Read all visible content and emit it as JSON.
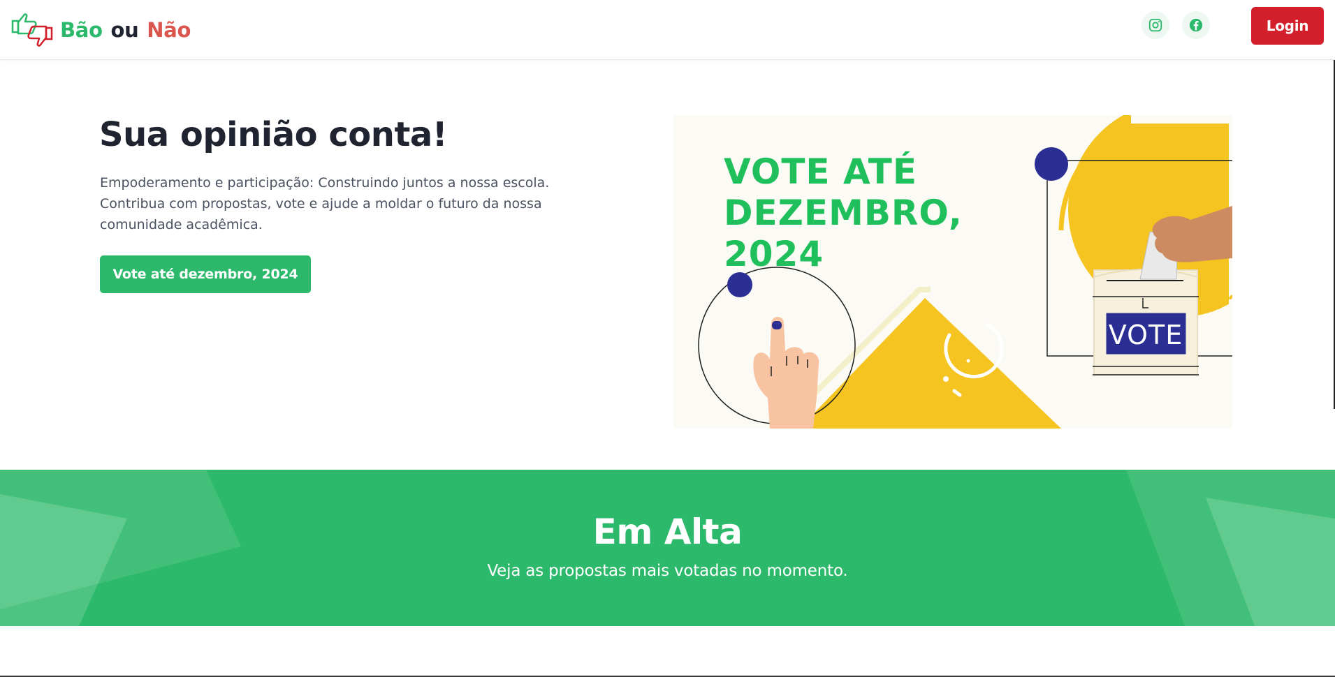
{
  "header": {
    "brand": {
      "part1": "Bão",
      "part2": "ou",
      "part3": "Não"
    },
    "social": [
      {
        "icon": "instagram-icon"
      },
      {
        "icon": "facebook-icon"
      }
    ],
    "login_label": "Login"
  },
  "hero": {
    "title": "Sua opinião conta!",
    "description": "Empoderamento e participação: Construindo juntos a nossa escola. Contribua com propostas, vote e ajude a moldar o futuro da nossa comunidade acadêmica.",
    "cta_label": "Vote até dezembro, 2024",
    "illustration": {
      "headline_lines": [
        "VOTE ATÉ",
        "DEZEMBRO,",
        "2024"
      ],
      "ballot_label": "VOTE"
    }
  },
  "trending": {
    "title": "Em Alta",
    "subtitle": "Veja as propostas mais votadas no momento."
  },
  "colors": {
    "brand_green": "#2db96b",
    "brand_red": "#d9554d",
    "login_red": "#d21f2b",
    "text_dark": "#1f2430",
    "illustration_green": "#1fbf5c",
    "illustration_yellow": "#f5c421",
    "illustration_navy": "#2b2f94"
  }
}
